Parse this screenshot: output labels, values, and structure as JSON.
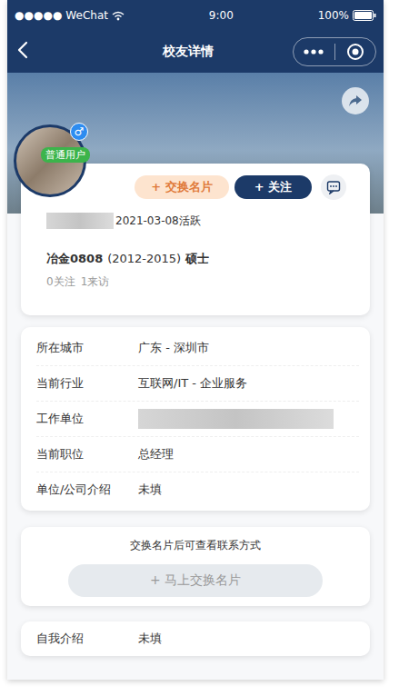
{
  "status_bar": {
    "signal": "●●●●●",
    "carrier": "WeChat",
    "time": "9:00",
    "battery": "100%"
  },
  "nav": {
    "title": "校友详情"
  },
  "profile": {
    "gender": "♂",
    "role_badge": "普通用户",
    "name_redacted": true,
    "buttons": [
      {
        "label": "+ 交换名片",
        "kind": "secondary"
      },
      {
        "label": "+ 关注",
        "kind": "primary"
      }
    ],
    "active": "2021-03-08活跃",
    "major": "冶金0808",
    "years": "(2012-2015)",
    "degree": "硕士",
    "stats": [
      "0关注",
      "1来访"
    ]
  },
  "details": [
    {
      "label": "所在城市",
      "value": "广东 - 深圳市",
      "redacted": false
    },
    {
      "label": "当前行业",
      "value": "互联网/IT - 企业服务",
      "redacted": false
    },
    {
      "label": "工作单位",
      "value": "",
      "redacted": true
    },
    {
      "label": "当前职位",
      "value": "总经理",
      "redacted": false
    },
    {
      "label": "单位/公司介绍",
      "value": "未填",
      "redacted": false
    }
  ],
  "contact": {
    "tip": "交换名片后可查看联系方式",
    "button": "+ 马上交换名片"
  },
  "intro": {
    "label": "自我介绍",
    "value": "未填"
  }
}
